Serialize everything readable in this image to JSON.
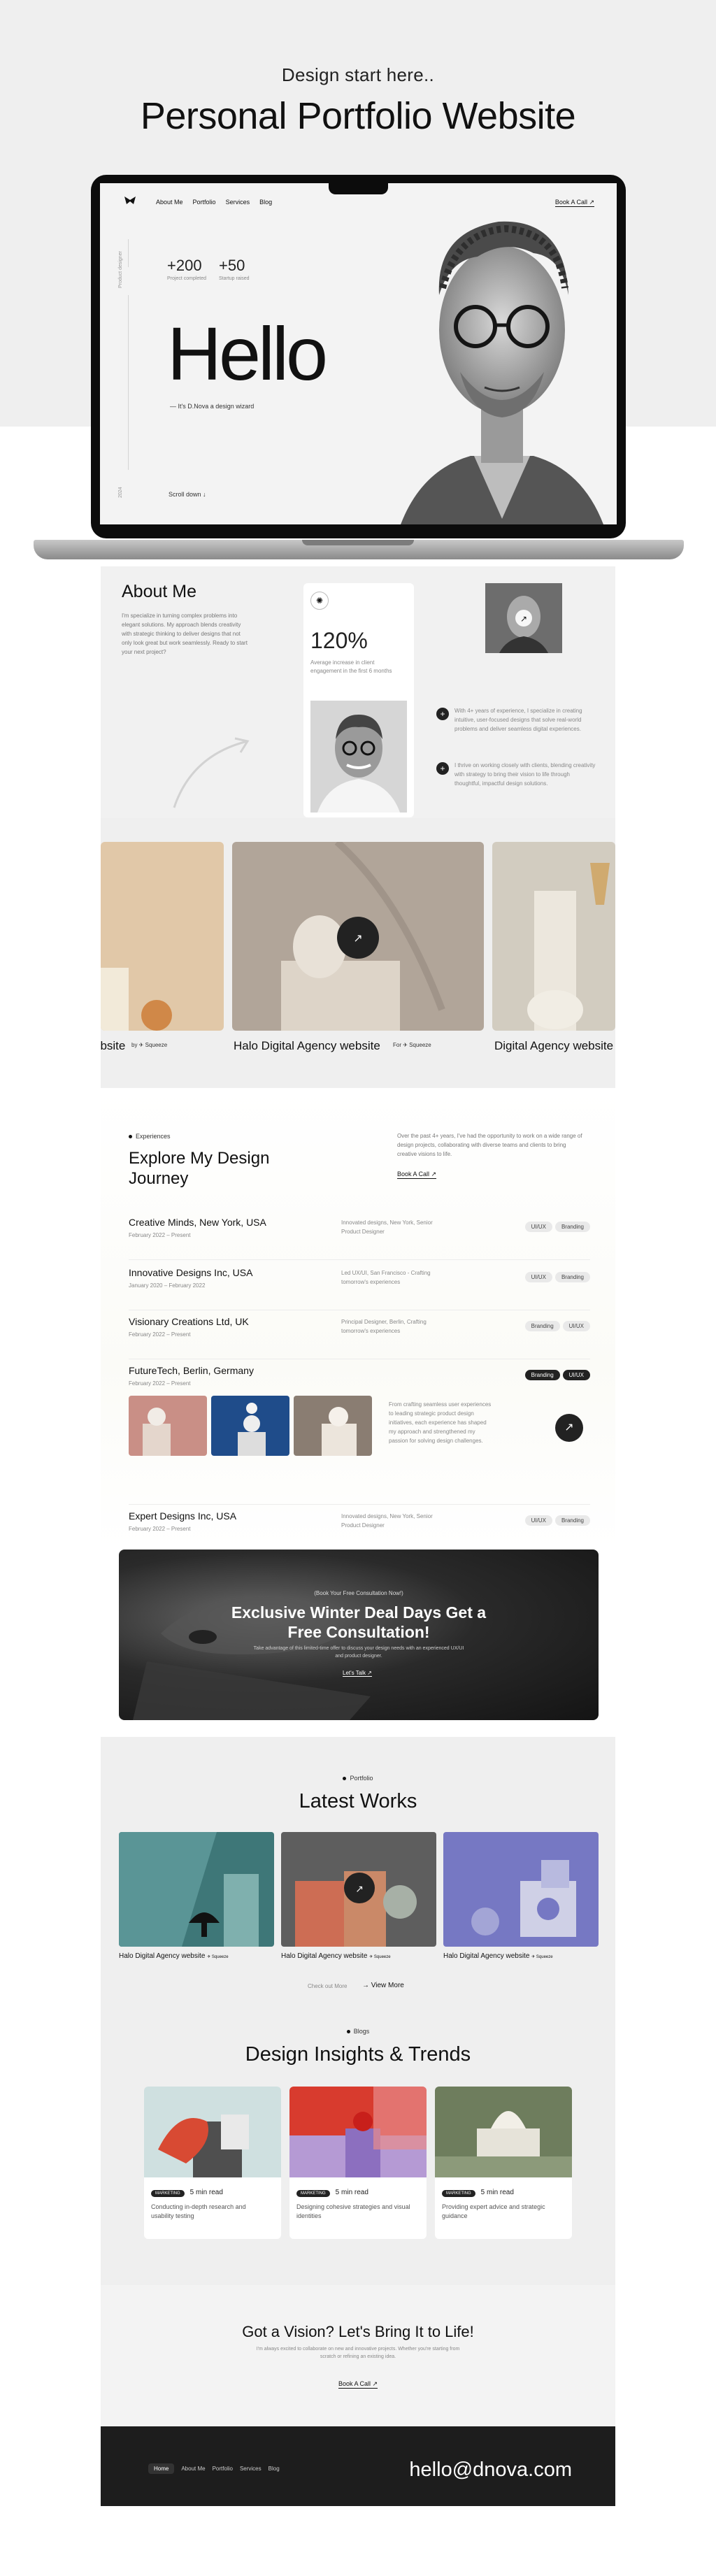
{
  "header": {
    "eyebrow": "Design start here..",
    "title": "Personal Portfolio Website"
  },
  "nav": {
    "links": [
      "About Me",
      "Portfolio",
      "Services",
      "Blog"
    ],
    "cta": "Book A Call ↗"
  },
  "hero": {
    "side_top": "Product designer",
    "side_bottom": "2024",
    "stats": [
      {
        "num": "+200",
        "label": "Project completed"
      },
      {
        "num": "+50",
        "label": "Startup raised"
      }
    ],
    "hello": "Hello",
    "sub": "— It's D.Nova a design wizard",
    "scroll": "Scroll down ↓"
  },
  "about": {
    "title": "About Me",
    "intro": "I'm specialize in turning complex problems into elegant solutions. My approach blends creativity with strategic thinking to deliver designs that not only look great but work seamlessly. Ready to start your next project?",
    "stat_num": "120%",
    "stat_desc": "Average increase in client engagement in the first 6 months",
    "bullets": [
      "With 4+ years of experience, I specialize in creating intuitive, user-focused designs that solve real-world problems and deliver seamless digital experiences.",
      "I thrive on working closely with clients, blending creativity with strategy to bring their vision to life through thoughtful, impactful design solutions."
    ]
  },
  "projects": [
    {
      "label": "ebsite",
      "by": "Squeeze"
    },
    {
      "label": "Halo Digital Agency website",
      "by": "Squeeze"
    },
    {
      "label": "Digital Agency website",
      "by": ""
    }
  ],
  "experience": {
    "eyebrow": "Experiences",
    "title": "Explore My Design Journey",
    "desc": "Over the past 4+ years, I've had the opportunity to work on a wide range of design projects, collaborating with diverse teams and clients to bring creative visions to life.",
    "cta": "Book A Call ↗",
    "rows": [
      {
        "company": "Creative Minds, New York, USA",
        "date": "February 2022 – Present",
        "role": "Innovated designs, New York, Senior Product Designer",
        "tags": [
          "UI/UX",
          "Branding"
        ]
      },
      {
        "company": "Innovative Designs Inc, USA",
        "date": "January 2020 – February 2022",
        "role": "Led UX/UI, San Francisco - Crafting tomorrow's experiences",
        "tags": [
          "UI/UX",
          "Branding"
        ]
      },
      {
        "company": "Visionary Creations Ltd, UK",
        "date": "February 2022 – Present",
        "role": "Principal Designer, Berlin, Crafting tomorrow's experiences",
        "tags": [
          "Branding",
          "UI/UX"
        ]
      },
      {
        "company": "FutureTech, Berlin, Germany",
        "date": "February 2022 – Present",
        "role": "From crafting seamless user experiences to leading strategic product design initiatives, each experience has shaped my approach and strengthened my passion for solving design challenges.",
        "tags": [
          "Branding",
          "UI/UX"
        ]
      },
      {
        "company": "Expert Designs Inc, USA",
        "date": "February 2022 – Present",
        "role": "Innovated designs, New York, Senior Product Designer",
        "tags": [
          "UI/UX",
          "Branding"
        ]
      }
    ]
  },
  "promo": {
    "eyebrow": "(Book Your Free Consultation Now!)",
    "title": "Exclusive Winter Deal Days Get a Free Consultation!",
    "desc": "Take advantage of this limited-time offer to discuss your design needs with an experienced UX/UI and product designer.",
    "cta": "Let's Talk ↗"
  },
  "works": {
    "eyebrow": "Portfolio",
    "title": "Latest Works",
    "items": [
      {
        "label": "Halo Digital Agency website",
        "by": "Squeeze"
      },
      {
        "label": "Halo Digital Agency website",
        "by": "Squeeze"
      },
      {
        "label": "Halo Digital Agency website",
        "by": "Squeeze"
      }
    ],
    "more_hint": "Check out More",
    "more": "View More"
  },
  "insights": {
    "eyebrow": "Blogs",
    "title": "Design Insights & Trends",
    "cards": [
      {
        "badge": "MARKETING",
        "read": "5 min read",
        "title": "Conducting in-depth research and usability testing"
      },
      {
        "badge": "MARKETING",
        "read": "5 min read",
        "title": "Designing cohesive strategies and visual identities"
      },
      {
        "badge": "MARKETING",
        "read": "5 min read",
        "title": "Providing expert advice and strategic guidance"
      }
    ]
  },
  "cta": {
    "title": "Got a Vision? Let's Bring It to Life!",
    "desc": "I'm always excited to collaborate on new and innovative projects. Whether you're starting from scratch or refining an existing idea.",
    "button": "Book A Call ↗"
  },
  "footer": {
    "links": [
      "Home",
      "About Me",
      "Portfolio",
      "Services",
      "Blog"
    ],
    "email": "hello@dnova.com"
  }
}
